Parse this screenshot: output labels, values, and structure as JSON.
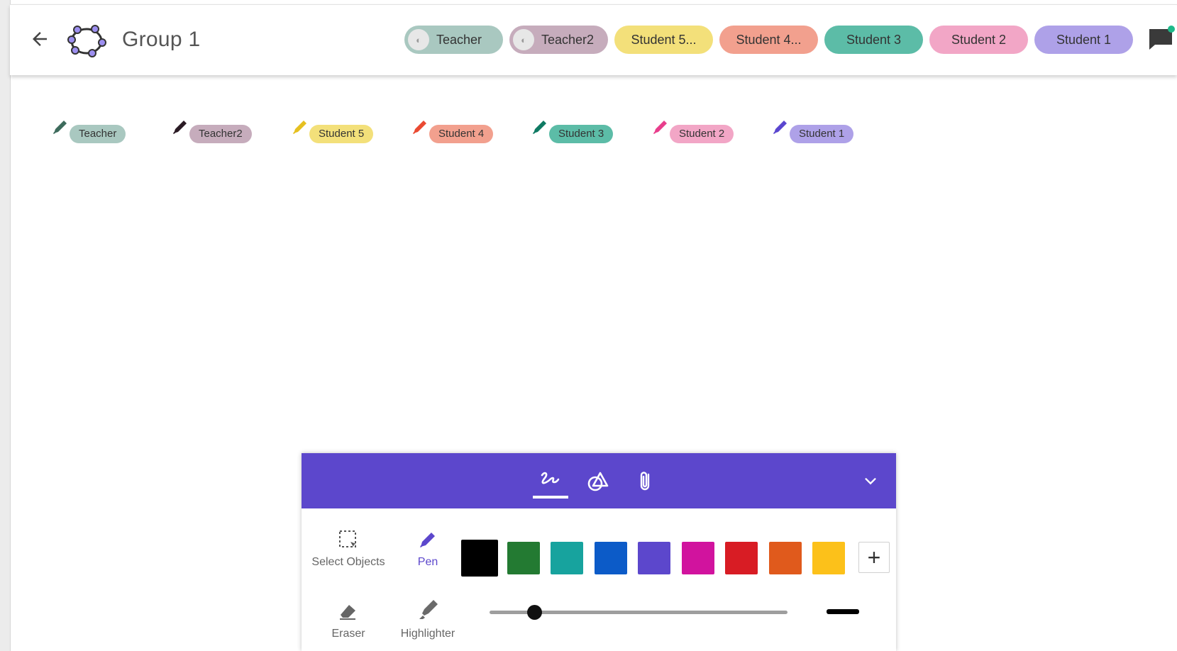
{
  "header": {
    "title": "Group 1",
    "chips": [
      {
        "label": "Teacher",
        "color": "#a9c8c0",
        "has_avatar": true
      },
      {
        "label": "Teacher2",
        "color": "#c6acbc",
        "has_avatar": true
      },
      {
        "label": "Student 5...",
        "color": "#f3e07a",
        "has_avatar": false
      },
      {
        "label": "Student 4...",
        "color": "#f2a08e",
        "has_avatar": false
      },
      {
        "label": "Student 3",
        "color": "#5cbca7",
        "has_avatar": false
      },
      {
        "label": "Student 2",
        "color": "#f2a6c6",
        "has_avatar": false
      },
      {
        "label": "Student 1",
        "color": "#aea1e8",
        "has_avatar": false
      }
    ],
    "icons": {
      "back": "arrow-left-icon",
      "logo": "geogebra-logo-icon",
      "chat": "chat-icon"
    }
  },
  "labels": [
    {
      "label": "Teacher",
      "tag_color": "#a9c8c0",
      "pen_color": "#3d6b5c"
    },
    {
      "label": "Teacher2",
      "tag_color": "#c6acbc",
      "pen_color": "#2a1a24"
    },
    {
      "label": "Student 5",
      "tag_color": "#f3e07a",
      "pen_color": "#e6c020"
    },
    {
      "label": "Student 4",
      "tag_color": "#f2a08e",
      "pen_color": "#ea4a32"
    },
    {
      "label": "Student 3",
      "tag_color": "#5cbca7",
      "pen_color": "#0f7a63"
    },
    {
      "label": "Student 2",
      "tag_color": "#f2a6c6",
      "pen_color": "#e83e8c"
    },
    {
      "label": "Student 1",
      "tag_color": "#aea1e8",
      "pen_color": "#5a46cf"
    }
  ],
  "toolbar": {
    "accent": "#5c47cc",
    "tabs": [
      {
        "name": "pen-tools-tab",
        "icon": "handwriting-icon",
        "active": true
      },
      {
        "name": "shapes-tab",
        "icon": "shapes-icon",
        "active": false
      },
      {
        "name": "attach-tab",
        "icon": "paperclip-icon",
        "active": false
      }
    ],
    "tools": {
      "select": "Select Objects",
      "pen": "Pen",
      "eraser": "Eraser",
      "highlighter": "Highlighter"
    },
    "colors": [
      "#000000",
      "#237a32",
      "#17a39e",
      "#0c5bc8",
      "#5c47cc",
      "#d1139e",
      "#d81c24",
      "#e05a1c",
      "#fcc11a"
    ],
    "selected_color_index": 0,
    "add_color_label": "+",
    "stroke_width_fraction": 0.15
  }
}
